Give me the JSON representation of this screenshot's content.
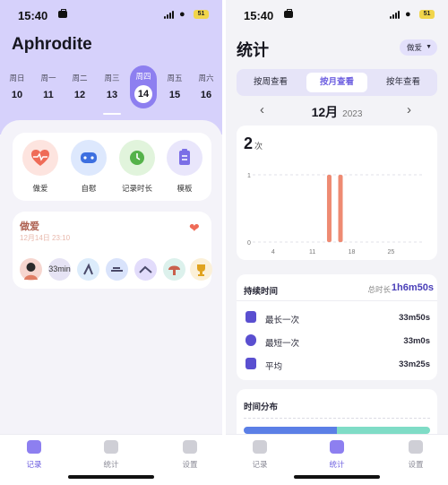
{
  "status_bar": {
    "time": "15:40",
    "battery": "51"
  },
  "left": {
    "app_title": "Aphrodite",
    "week": [
      {
        "name": "周日",
        "num": "10"
      },
      {
        "name": "周一",
        "num": "11"
      },
      {
        "name": "周二",
        "num": "12"
      },
      {
        "name": "周三",
        "num": "13"
      },
      {
        "name": "周四",
        "num": "14"
      },
      {
        "name": "周五",
        "num": "15"
      },
      {
        "name": "周六",
        "num": "16"
      }
    ],
    "selected_day": "14",
    "quick_actions": [
      {
        "label": "做爱",
        "icon": "heart-pulse-icon"
      },
      {
        "label": "自慰",
        "icon": "gamepad-icon"
      },
      {
        "label": "记录时长",
        "icon": "clock-icon"
      },
      {
        "label": "模板",
        "icon": "clipboard-icon"
      }
    ],
    "record": {
      "title": "做爱",
      "date": "12月14日 23:10",
      "duration_tag": "33min"
    }
  },
  "nav": {
    "items": [
      "记录",
      "统计",
      "设置"
    ]
  },
  "right": {
    "title": "统计",
    "filter": "做爱",
    "tabs": [
      "按周查看",
      "按月查看",
      "按年查看"
    ],
    "active_tab": "按月查看",
    "month": "12月",
    "year": "2023",
    "count": "2",
    "count_unit": "次",
    "duration": {
      "title": "持续时间",
      "total_label": "总时长",
      "total": "1h6m50s",
      "rows": [
        {
          "label": "最长一次",
          "value": "33m50s",
          "icon": "hourglass-icon"
        },
        {
          "label": "最短一次",
          "value": "33m0s",
          "icon": "stopwatch-icon"
        },
        {
          "label": "平均",
          "value": "33m25s",
          "icon": "calculator-icon"
        }
      ]
    },
    "distribution_title": "时间分布"
  },
  "colors": {
    "accent": "#8d7ff0",
    "header_bg": "#d6d1fb",
    "bar": "#ee8a72",
    "dist_a": "#5b7fe6",
    "dist_b": "#7fdcc6"
  },
  "chart_data": {
    "type": "bar",
    "x": [
      14,
      16
    ],
    "values": [
      1,
      1
    ],
    "x_ticks": [
      "4",
      "11",
      "18",
      "25"
    ],
    "y_ticks": [
      "0",
      "1"
    ],
    "xlim": [
      1,
      31
    ],
    "ylim": [
      0,
      1
    ]
  }
}
